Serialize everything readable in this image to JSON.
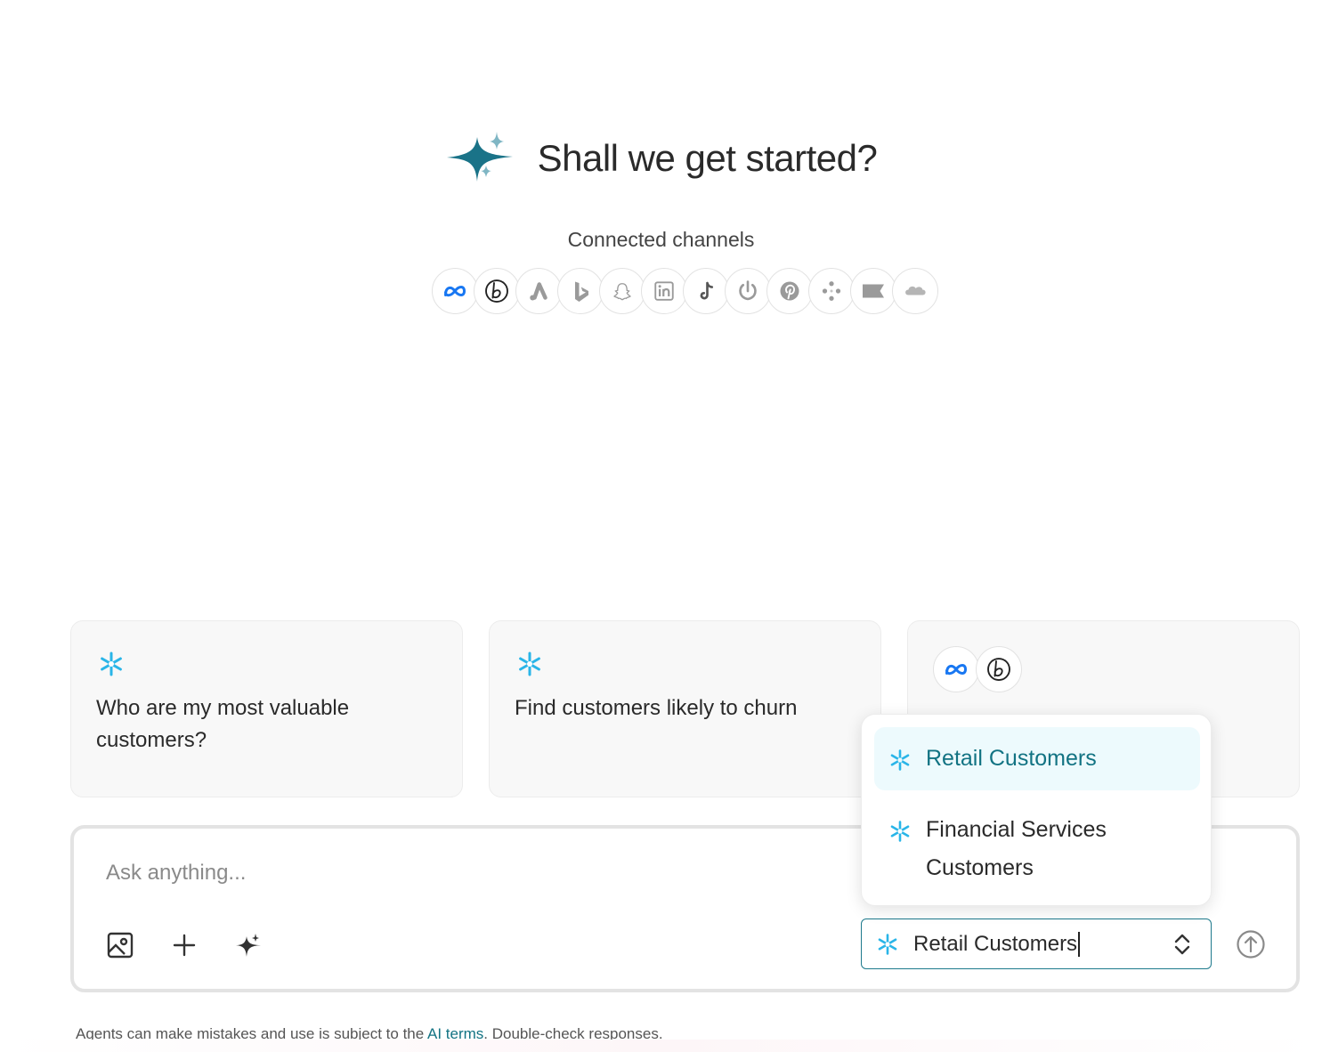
{
  "hero": {
    "title": "Shall we get started?",
    "logo_icon": "sparkle-logo-icon"
  },
  "channels": {
    "label": "Connected channels",
    "items": [
      "meta-icon",
      "bing-b-icon",
      "google-ads-icon",
      "bing-icon",
      "snapchat-icon",
      "linkedin-icon",
      "tiktok-icon",
      "power-icon",
      "pinterest-icon",
      "dots-icon",
      "flag-icon",
      "salesforce-icon"
    ]
  },
  "cards": [
    {
      "icon": "snowflake-icon",
      "text": "Who are my most valuable customers?"
    },
    {
      "icon": "snowflake-icon",
      "text": "Find customers likely to churn"
    },
    {
      "icons": [
        "meta-icon",
        "bing-b-icon"
      ],
      "text": ""
    }
  ],
  "composer": {
    "placeholder": "Ask anything...",
    "tools": [
      "image-icon",
      "plus-icon",
      "sparkle-icon"
    ],
    "selected_source": "Retail Customers",
    "send_icon": "arrow-up-circle-icon"
  },
  "dropdown": {
    "options": [
      "Retail Customers",
      "Financial Services Customers"
    ],
    "active_index": 0
  },
  "footer": {
    "prefix": "Agents can make mistakes and use is subject to the ",
    "link": "AI terms",
    "suffix": ". Double-check responses."
  },
  "colors": {
    "accent": "#127383",
    "snowflake": "#29b5e8",
    "meta": "#1877f2"
  }
}
